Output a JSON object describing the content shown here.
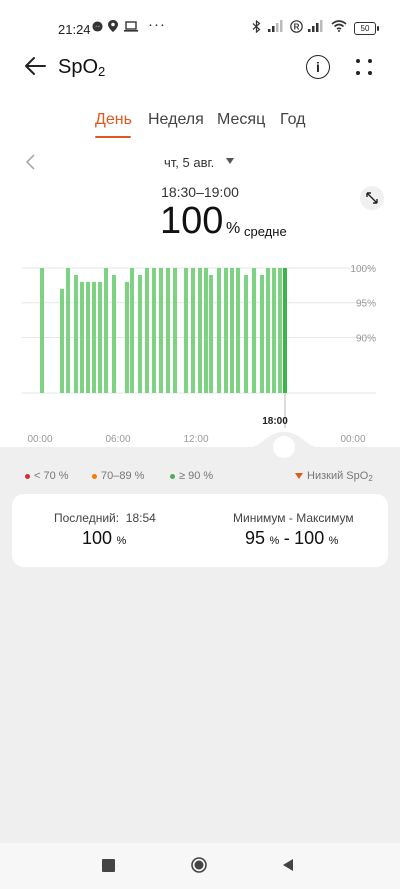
{
  "status_bar": {
    "time": "21:24",
    "battery": "50"
  },
  "header": {
    "title": "SpO",
    "title_sub": "2"
  },
  "tabs": [
    {
      "label": "День",
      "active": true
    },
    {
      "label": "Неделя",
      "active": false
    },
    {
      "label": "Месяц",
      "active": false
    },
    {
      "label": "Год",
      "active": false
    }
  ],
  "date_selector": {
    "date": "чт, 5 авг."
  },
  "summary": {
    "time_range": "18:30–19:00",
    "value": "100",
    "unit": "%",
    "label": "средне"
  },
  "chart_data": {
    "type": "bar",
    "y_tick_labels": [
      "100%",
      "95%",
      "90%"
    ],
    "x_tick_labels": [
      "00:00",
      "06:00",
      "12:00",
      "18:00",
      "00:00"
    ],
    "selected_time": "18:00",
    "ylim": [
      82,
      100
    ],
    "values": [
      100,
      97,
      100,
      99,
      98,
      98,
      98,
      98,
      100,
      99,
      98,
      100,
      99,
      100,
      100,
      100,
      100,
      100,
      100,
      100,
      100,
      100,
      99,
      100,
      100,
      100,
      100,
      99,
      100,
      99,
      100,
      100,
      100,
      100
    ],
    "bar_color": "#7dd382",
    "selected_bar_color": "#3bb54a"
  },
  "legend": {
    "low70": "< 70 %",
    "mid": "70–89 %",
    "high": "≥ 90 %",
    "low_spo2": "Низкий SpO",
    "low_spo2_sub": "2",
    "colors": {
      "low70": "#d32f2f",
      "mid": "#f57c00",
      "high": "#4caf50",
      "low_marker": "#e0591f"
    }
  },
  "card": {
    "last_label": "Последний:",
    "last_time": "18:54",
    "last_value": "100",
    "last_unit": "%",
    "range_label": "Минимум - Максимум",
    "min_value": "95",
    "max_value": "100",
    "unit": "%",
    "dash": "-"
  },
  "accent_color": "#e0591f"
}
